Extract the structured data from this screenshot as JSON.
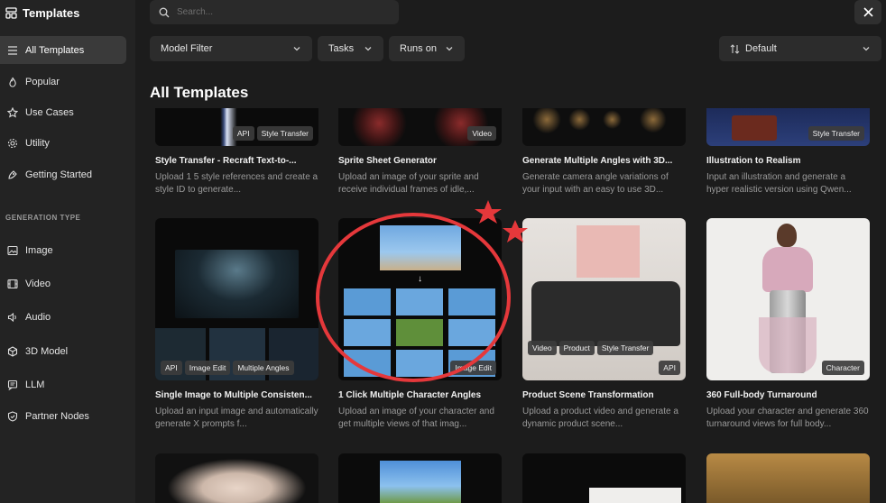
{
  "sidebar": {
    "brand_icon": "template-icon",
    "title": "Templates",
    "items": [
      {
        "label": "All Templates",
        "icon": "list-icon",
        "active": true
      },
      {
        "label": "Popular",
        "icon": "flame-icon"
      },
      {
        "label": "Use Cases",
        "icon": "star-icon"
      },
      {
        "label": "Utility",
        "icon": "gear-icon"
      },
      {
        "label": "Getting Started",
        "icon": "rocket-icon"
      }
    ],
    "section_title": "GENERATION TYPE",
    "types": [
      {
        "label": "Image",
        "icon": "image-icon"
      },
      {
        "label": "Video",
        "icon": "video-icon"
      },
      {
        "label": "Audio",
        "icon": "audio-icon"
      },
      {
        "label": "3D Model",
        "icon": "cube-icon"
      },
      {
        "label": "LLM",
        "icon": "chat-icon"
      },
      {
        "label": "Partner Nodes",
        "icon": "badge-icon"
      }
    ]
  },
  "search": {
    "placeholder": "Search..."
  },
  "filters": {
    "model": "Model Filter",
    "tasks": "Tasks",
    "runs_on": "Runs on",
    "sort": "Default"
  },
  "heading": "All Templates",
  "row1": [
    {
      "title": "Style Transfer - Recraft Text-to-...",
      "desc": "Upload 1 5 style references and create a style ID to generate...",
      "tags": [
        "API",
        "Style Transfer"
      ]
    },
    {
      "title": "Sprite Sheet Generator",
      "desc": "Upload an image of your sprite and receive individual frames of idle,...",
      "tags": [
        "Video"
      ]
    },
    {
      "title": "Generate Multiple Angles with 3D...",
      "desc": "Generate camera angle variations of your input with an easy to use 3D...",
      "tags": []
    },
    {
      "title": "Illustration to Realism",
      "desc": "Input an illustration and generate a hyper realistic version using Qwen...",
      "tags": [
        "Style Transfer"
      ]
    }
  ],
  "row2": [
    {
      "title": "Single Image to Multiple Consisten...",
      "desc": "Upload an input image and automatically generate X prompts f...",
      "tags": [
        "API",
        "Image Edit",
        "Multiple Angles"
      ]
    },
    {
      "title": "1 Click Multiple Character Angles",
      "desc": "Upload an image of your character and get multiple views of that imag...",
      "tags": [
        "Image Edit"
      ]
    },
    {
      "title": "Product Scene Transformation",
      "desc": "Upload a product video and generate a dynamic product scene...",
      "tags": [
        "Video",
        "Product",
        "Style Transfer"
      ],
      "tag_extra": "API"
    },
    {
      "title": "360 Full-body Turnaround",
      "desc": "Upload your character and generate 360 turnaround views for full body...",
      "tags": [
        "Character"
      ]
    }
  ]
}
